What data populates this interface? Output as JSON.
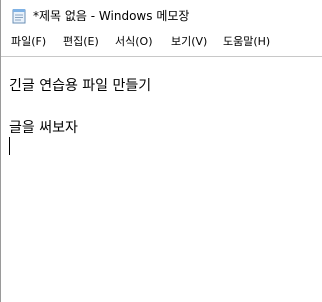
{
  "window": {
    "title": "*제목 없음 - Windows 메모장",
    "app_icon": "notepad-icon"
  },
  "menu": {
    "file": "파일(F)",
    "edit": "편집(E)",
    "format": "서식(O)",
    "view": "보기(V)",
    "help": "도움말(H)"
  },
  "editor": {
    "lines": [
      "긴글 연습용 파일 만들기",
      "",
      "글을 써보자",
      ""
    ]
  },
  "colors": {
    "background": "#ffffff",
    "text": "#000000",
    "border": "#c8c8c8"
  }
}
